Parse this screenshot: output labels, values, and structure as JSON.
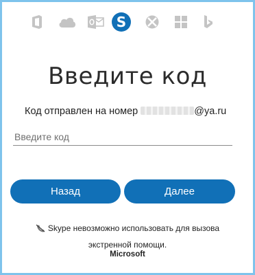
{
  "header": {
    "icons": [
      "office-icon",
      "onedrive-icon",
      "outlook-icon",
      "skype-icon",
      "xbox-icon",
      "windows-icon",
      "bing-icon"
    ],
    "active_icon": "skype-icon",
    "accent_color": "#1170b7",
    "inactive_icon_color": "#c4c4c4"
  },
  "main": {
    "title": "Введите код",
    "sent_prefix": "Код отправлен на номер",
    "sent_suffix": "@ya.ru",
    "code_placeholder": "Введите код",
    "code_value": ""
  },
  "actions": {
    "back_label": "Назад",
    "next_label": "Далее"
  },
  "footer": {
    "notice_line1": "Skype невозможно использовать для вызова",
    "notice_line2": "экстренной помощи.",
    "notice_icon": "no-phone-icon",
    "brand": "Microsoft"
  }
}
